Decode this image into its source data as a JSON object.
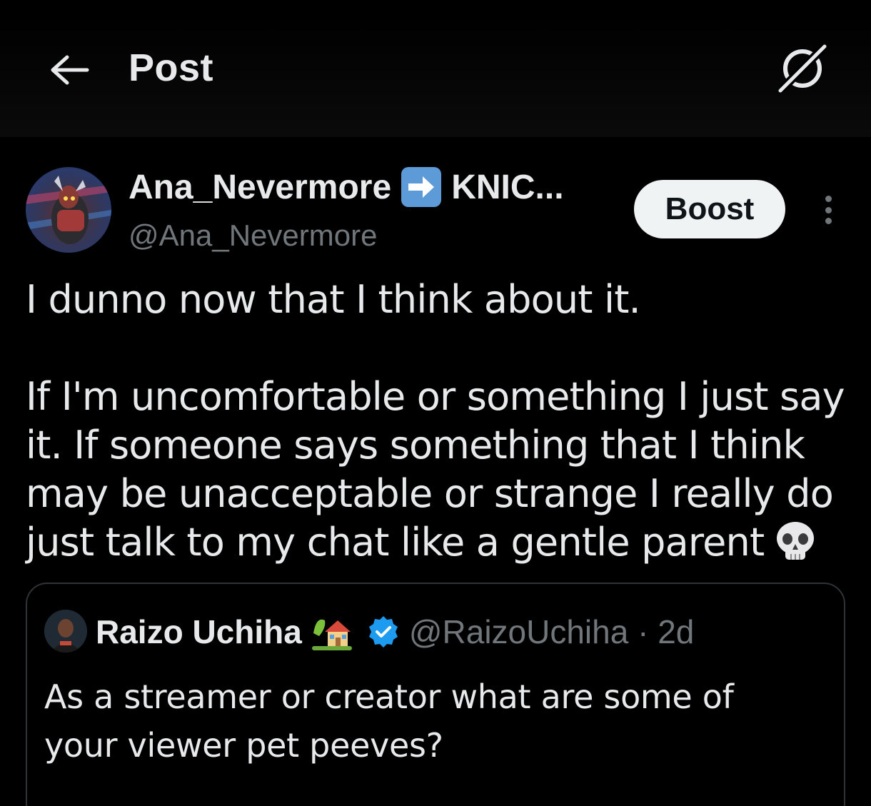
{
  "header": {
    "title": "Post",
    "back_icon": "arrow-left-icon",
    "right_icon": "disconnected-globe-icon"
  },
  "post": {
    "author": {
      "display_name": "Ana_Nevermore",
      "name_emoji": "right-arrow-emoji",
      "display_name_rest": "KNIC...",
      "handle": "@Ana_Nevermore"
    },
    "boost_label": "Boost",
    "text_lines": [
      "I dunno now that I think about it.",
      "If I'm uncomfortable or something I just say it. If someone says something that I think may be unacceptable or strange I really do just talk to my chat like a gentle parent"
    ],
    "trailing_emoji": "skull-emoji"
  },
  "quote": {
    "author_name": "Raizo Uchiha",
    "name_emoji": "house-with-garden-emoji",
    "verified": true,
    "handle_and_time": "@RaizoUchiha · 2d",
    "text": "As a streamer or creator what are some of your viewer pet peeves?"
  },
  "colors": {
    "background": "#000000",
    "text_primary": "#e7e9ea",
    "text_secondary": "#71767b",
    "verified_blue": "#1d9bf0",
    "border": "#2f3336",
    "boost_bg": "#eff3f4"
  }
}
